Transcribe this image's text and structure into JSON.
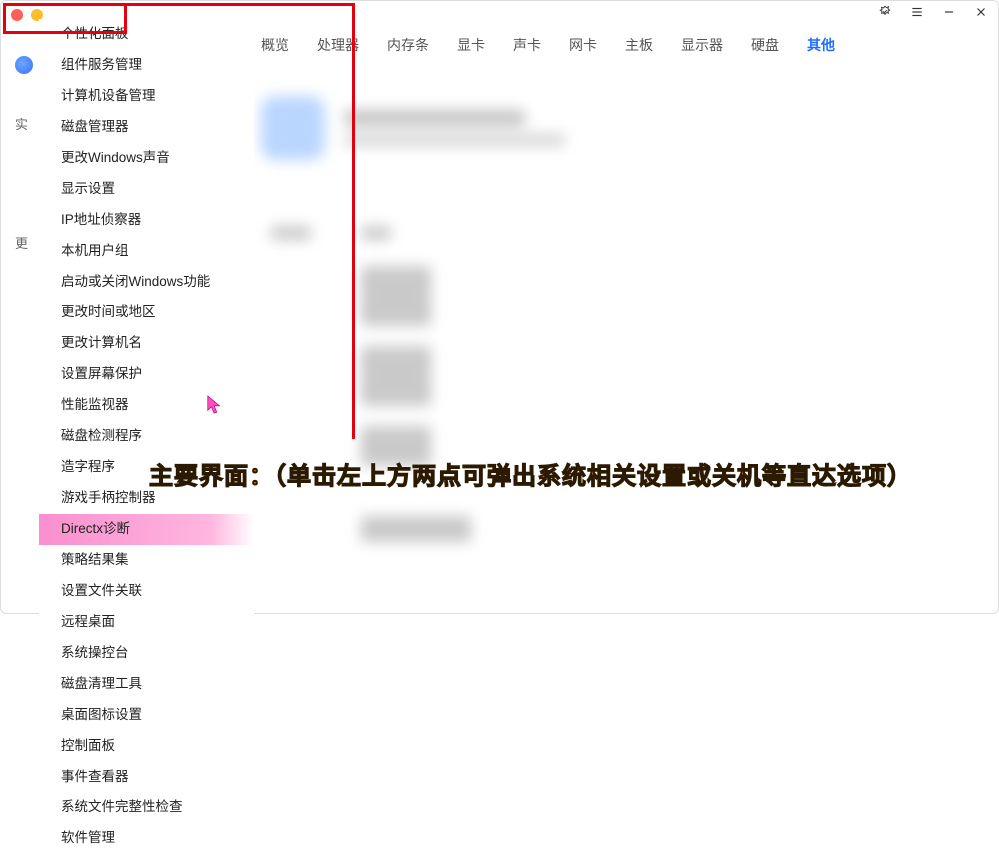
{
  "titlebar": {
    "traffic_red": "close",
    "traffic_yellow": "minimize"
  },
  "window_controls": {
    "badge": "badge-icon",
    "menu": "hamburger-icon",
    "min": "minimize-icon",
    "close": "close-icon"
  },
  "sidebar": {
    "label1": "实",
    "label2": "更"
  },
  "tabs": [
    {
      "label": "概览",
      "active": false
    },
    {
      "label": "处理器",
      "active": false
    },
    {
      "label": "内存条",
      "active": false
    },
    {
      "label": "显卡",
      "active": false
    },
    {
      "label": "声卡",
      "active": false
    },
    {
      "label": "网卡",
      "active": false
    },
    {
      "label": "主板",
      "active": false
    },
    {
      "label": "显示器",
      "active": false
    },
    {
      "label": "硬盘",
      "active": false
    },
    {
      "label": "其他",
      "active": true
    }
  ],
  "menu": {
    "items": [
      "个性化面板",
      "组件服务管理",
      "计算机设备管理",
      "磁盘管理器",
      "更改Windows声音",
      "显示设置",
      "IP地址侦察器",
      "本机用户组",
      "启动或关闭Windows功能",
      "更改时间或地区",
      "更改计算机名",
      "设置屏幕保护",
      "性能监视器",
      "磁盘检测程序",
      "造字程序",
      "游戏手柄控制器",
      "Directx诊断",
      "策略结果集",
      "设置文件关联",
      "远程桌面",
      "系统操控台",
      "磁盘清理工具",
      "桌面图标设置",
      "控制面板",
      "事件查看器",
      "系统文件完整性检查",
      "软件管理"
    ],
    "highlighted_index": 16
  },
  "annotation": {
    "text": "主要界面：（单击左上方两点可弹出系统相关设置或关机等直达选项）"
  }
}
